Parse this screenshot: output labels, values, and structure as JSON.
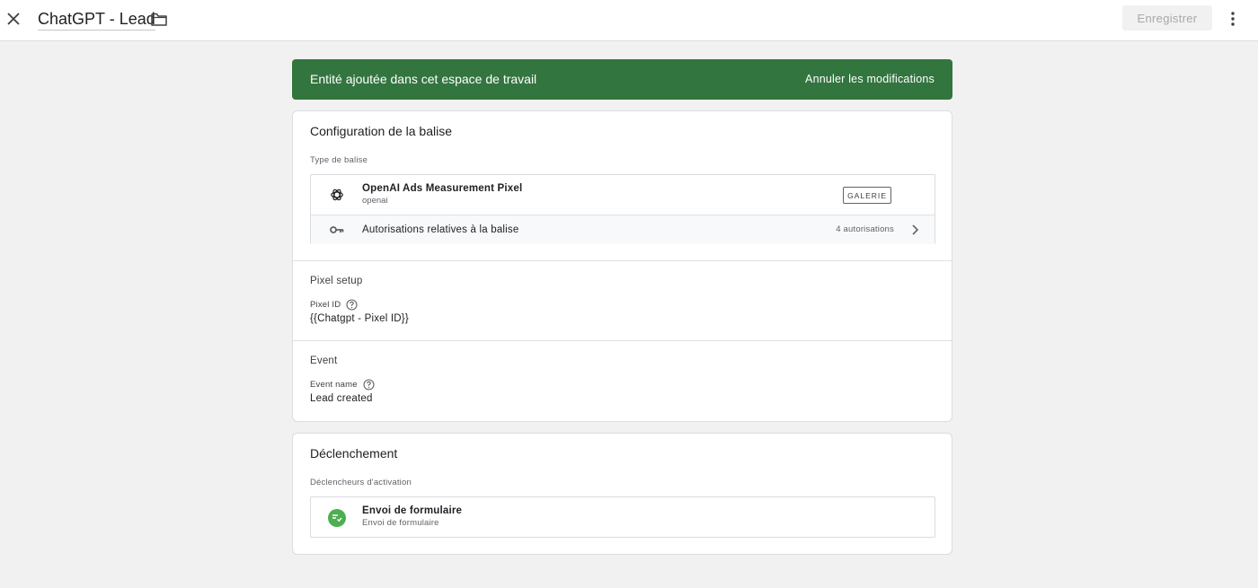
{
  "header": {
    "title": "ChatGPT - Lead",
    "save_label": "Enregistrer",
    "icons": {
      "close": "close-icon",
      "folder": "folder-icon",
      "more": "more-vert-icon"
    }
  },
  "banner": {
    "message": "Entité ajoutée dans cet espace de travail",
    "action": "Annuler les modifications",
    "color": "#33753f"
  },
  "tag_config": {
    "heading": "Configuration de la balise",
    "type_label": "Type de balise",
    "tag": {
      "name": "OpenAI Ads Measurement Pixel",
      "provider": "openai",
      "gallery_label": "GALERIE",
      "icon": "openai-icon"
    },
    "permissions": {
      "label": "Autorisations relatives à la balise",
      "count": "4 autorisations",
      "icon": "key-icon"
    },
    "pixel_setup": {
      "title": "Pixel setup",
      "field_label": "Pixel ID",
      "field_value": "{{Chatgpt - Pixel ID}}"
    },
    "event": {
      "title": "Event",
      "field_label": "Event name",
      "field_value": "Lead created"
    }
  },
  "triggering": {
    "heading": "Déclenchement",
    "label": "Déclencheurs d'activation",
    "trigger": {
      "name": "Envoi de formulaire",
      "type": "Envoi de formulaire",
      "icon": "form-submit-icon",
      "icon_color": "#4caf50"
    }
  }
}
